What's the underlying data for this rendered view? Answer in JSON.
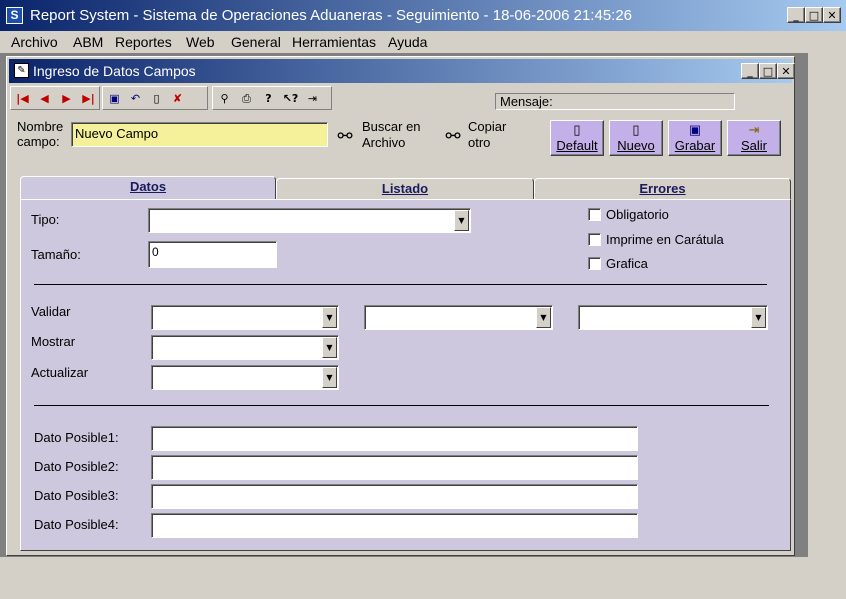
{
  "app": {
    "title": "Report System - Sistema de Operaciones Aduaneras - Seguimiento - 18-06-2006 21:45:26",
    "icon_letter": "S"
  },
  "menu": [
    "Archivo",
    "ABM",
    "Reportes",
    "Web",
    "General",
    "Herramientas",
    "Ayuda"
  ],
  "child_window": {
    "title": "Ingreso de Datos Campos"
  },
  "toolbar": {
    "message_label": "Mensaje:"
  },
  "header": {
    "nombre_label_1": "Nombre",
    "nombre_label_2": "campo:",
    "nombre_value": "Nuevo Campo",
    "buscar_1": "Buscar en",
    "buscar_2": "Archivo",
    "copiar_1": "Copiar",
    "copiar_2": "otro"
  },
  "buttons": {
    "default": "Default",
    "nuevo": "Nuevo",
    "grabar": "Grabar",
    "salir": "Salir"
  },
  "tabs": [
    "Datos",
    "Listado",
    "Errores"
  ],
  "datos": {
    "tipo_label": "Tipo:",
    "tipo_value": "",
    "tamano_label": "Tamaño:",
    "tamano_value": "0",
    "obligatorio": "Obligatorio",
    "obligatorio_checked": false,
    "imprime": "Imprime en Carátula",
    "imprime_checked": false,
    "grafica": "Grafica",
    "grafica_checked": false,
    "validar": "Validar",
    "mostrar": "Mostrar",
    "actualizar": "Actualizar",
    "dato1": "Dato Posible1:",
    "dato2": "Dato Posible2:",
    "dato3": "Dato Posible3:",
    "dato4": "Dato Posible4:"
  },
  "colors": {
    "title_gradient_start": "#0a246a",
    "title_gradient_end": "#a6caf0",
    "purple_button": "#c3b0e8",
    "tab_panel": "#cdc8de",
    "name_field": "#f5f09a"
  }
}
